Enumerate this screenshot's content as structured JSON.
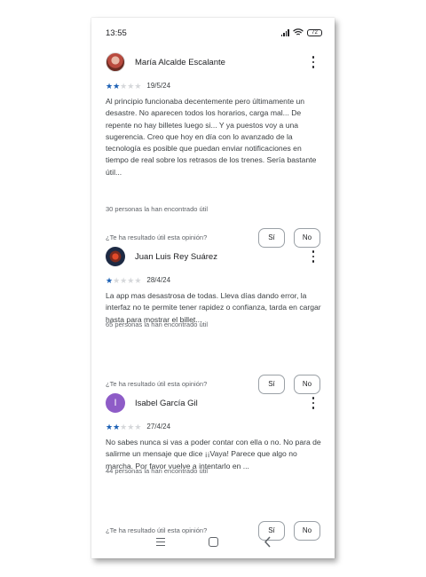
{
  "status_bar": {
    "time": "13:55",
    "battery": "72"
  },
  "reviews": [
    {
      "name": "María Alcalde Escalante",
      "stars": 2,
      "date": "19/5/24",
      "text": "Al principio funcionaba decentemente pero últimamente un desastre. No aparecen todos los horarios, carga mal... De repente no hay billetes luego si... Y ya puestos voy a una sugerencia. Creo que hoy en día con lo avanzado de la tecnología es posible que puedan enviar notificaciones en tiempo de real sobre los retrasos de los trenes. Sería bastante útil...",
      "helpful_count": "30 personas la han encontrado útil",
      "helpful_question": "¿Te ha resultado útil esta opinión?",
      "yes_label": "Sí",
      "no_label": "No"
    },
    {
      "name": "Juan Luis Rey Suárez",
      "stars": 1,
      "date": "28/4/24",
      "text": "La app mas desastrosa de todas. Lleva días dando error, la interfaz no te permite tener rapidez o confianza, tarda en cargar hasta para mostrar el billet...",
      "helpful_count": "65 personas la han encontrado útil",
      "helpful_question": "¿Te ha resultado útil esta opinión?",
      "yes_label": "Sí",
      "no_label": "No"
    },
    {
      "name": "Isabel García Gil",
      "avatar_letter": "I",
      "stars": 2,
      "date": "27/4/24",
      "text": "No sabes nunca si vas a poder contar con ella o no. No para de salirme un mensaje que dice ¡¡Vaya! Parece que algo no marcha. Por favor vuelve a intentarlo en ...",
      "helpful_count": "44 personas la han encontrado útil",
      "helpful_question": "¿Te ha resultado útil esta opinión?",
      "yes_label": "Sí",
      "no_label": "No"
    }
  ],
  "colors": {
    "star_filled": "#1a5fb4",
    "star_empty": "#d5d7da",
    "avatar_isabel": "#8e5cc7"
  },
  "icons": [
    "signal-icon",
    "wifi-icon",
    "battery-icon",
    "more-options-icon",
    "star-icon",
    "nav-menu-icon",
    "nav-home-icon",
    "nav-back-icon"
  ]
}
